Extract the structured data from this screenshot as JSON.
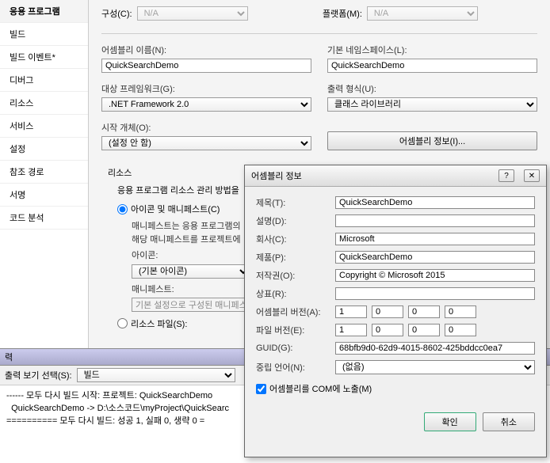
{
  "sidebar": {
    "items": [
      {
        "label": "응용 프로그램"
      },
      {
        "label": "빌드"
      },
      {
        "label": "빌드 이벤트*"
      },
      {
        "label": "디버그"
      },
      {
        "label": "리소스"
      },
      {
        "label": "서비스"
      },
      {
        "label": "설정"
      },
      {
        "label": "참조 경로"
      },
      {
        "label": "서명"
      },
      {
        "label": "코드 분석"
      }
    ]
  },
  "config": {
    "config_label": "구성(C):",
    "config_value": "N/A",
    "platform_label": "플랫폼(M):",
    "platform_value": "N/A"
  },
  "fields": {
    "assembly_name_label": "어셈블리 이름(N):",
    "assembly_name_value": "QuickSearchDemo",
    "namespace_label": "기본 네임스페이스(L):",
    "namespace_value": "QuickSearchDemo",
    "framework_label": "대상 프레임워크(G):",
    "framework_value": ".NET Framework 2.0",
    "output_type_label": "출력 형식(U):",
    "output_type_value": "클래스 라이브러리",
    "startup_label": "시작 개체(O):",
    "startup_value": "(설정 안 함)",
    "assembly_info_btn": "어셈블리 정보(I)..."
  },
  "resources": {
    "title": "리소스",
    "desc": "응용 프로그램 리소스 관리 방법을",
    "radio1_label": "아이콘 및 매니페스트(C)",
    "radio1_desc1": "매니페스트는 응용 프로그램의",
    "radio1_desc2": "해당 매니페스트를 프로젝트에",
    "icon_label": "아이콘:",
    "icon_value": "(기본 아이콘)",
    "manifest_label": "매니페스트:",
    "manifest_value": "기본 설정으로 구성된 매니페스",
    "radio2_label": "리소스 파일(S):"
  },
  "output": {
    "header": "력",
    "toolbar_label": "출력 보기 선택(S):",
    "toolbar_value": "빌드",
    "line1": "------ 모두 다시 빌드 시작: 프로젝트: QuickSearchDemo",
    "line2": "  QuickSearchDemo -> D:\\소스코드\\myProject\\QuickSearc",
    "line3": "========== 모두 다시 빌드: 성공 1, 실패 0, 생략 0 ="
  },
  "dialog": {
    "title": "어셈블리 정보",
    "title_label": "제목(T):",
    "title_value": "QuickSearchDemo",
    "desc_label": "설명(D):",
    "desc_value": "",
    "company_label": "회사(C):",
    "company_value": "Microsoft",
    "product_label": "제품(P):",
    "product_value": "QuickSearchDemo",
    "copyright_label": "저작권(O):",
    "copyright_value": "Copyright © Microsoft 2015",
    "trademark_label": "상표(R):",
    "trademark_value": "",
    "asm_version_label": "어셈블리 버전(A):",
    "asm_version": [
      "1",
      "0",
      "0",
      "0"
    ],
    "file_version_label": "파일 버전(E):",
    "file_version": [
      "1",
      "0",
      "0",
      "0"
    ],
    "guid_label": "GUID(G):",
    "guid_value": "68bfb9d0-62d9-4015-8602-425bddcc0ea7",
    "neutral_lang_label": "중립 언어(N):",
    "neutral_lang_value": "(없음)",
    "com_checkbox": "어셈블리를 COM에 노출(M)",
    "ok_btn": "확인",
    "cancel_btn": "취소",
    "help": "?",
    "close": "✕"
  }
}
